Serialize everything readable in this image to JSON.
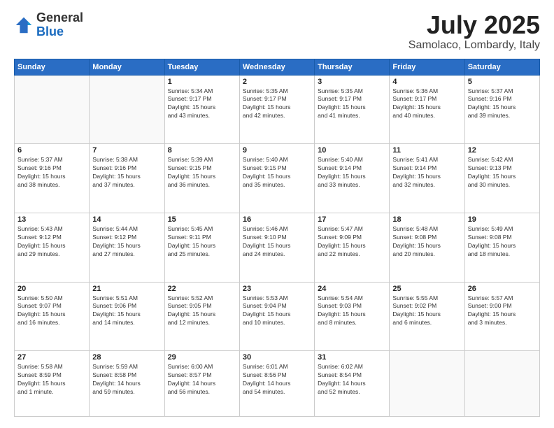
{
  "header": {
    "logo": {
      "general": "General",
      "blue": "Blue"
    },
    "title": "July 2025",
    "location": "Samolaco, Lombardy, Italy"
  },
  "calendar": {
    "days_of_week": [
      "Sunday",
      "Monday",
      "Tuesday",
      "Wednesday",
      "Thursday",
      "Friday",
      "Saturday"
    ],
    "weeks": [
      [
        {
          "day": "",
          "info": ""
        },
        {
          "day": "",
          "info": ""
        },
        {
          "day": "1",
          "info": "Sunrise: 5:34 AM\nSunset: 9:17 PM\nDaylight: 15 hours\nand 43 minutes."
        },
        {
          "day": "2",
          "info": "Sunrise: 5:35 AM\nSunset: 9:17 PM\nDaylight: 15 hours\nand 42 minutes."
        },
        {
          "day": "3",
          "info": "Sunrise: 5:35 AM\nSunset: 9:17 PM\nDaylight: 15 hours\nand 41 minutes."
        },
        {
          "day": "4",
          "info": "Sunrise: 5:36 AM\nSunset: 9:17 PM\nDaylight: 15 hours\nand 40 minutes."
        },
        {
          "day": "5",
          "info": "Sunrise: 5:37 AM\nSunset: 9:16 PM\nDaylight: 15 hours\nand 39 minutes."
        }
      ],
      [
        {
          "day": "6",
          "info": "Sunrise: 5:37 AM\nSunset: 9:16 PM\nDaylight: 15 hours\nand 38 minutes."
        },
        {
          "day": "7",
          "info": "Sunrise: 5:38 AM\nSunset: 9:16 PM\nDaylight: 15 hours\nand 37 minutes."
        },
        {
          "day": "8",
          "info": "Sunrise: 5:39 AM\nSunset: 9:15 PM\nDaylight: 15 hours\nand 36 minutes."
        },
        {
          "day": "9",
          "info": "Sunrise: 5:40 AM\nSunset: 9:15 PM\nDaylight: 15 hours\nand 35 minutes."
        },
        {
          "day": "10",
          "info": "Sunrise: 5:40 AM\nSunset: 9:14 PM\nDaylight: 15 hours\nand 33 minutes."
        },
        {
          "day": "11",
          "info": "Sunrise: 5:41 AM\nSunset: 9:14 PM\nDaylight: 15 hours\nand 32 minutes."
        },
        {
          "day": "12",
          "info": "Sunrise: 5:42 AM\nSunset: 9:13 PM\nDaylight: 15 hours\nand 30 minutes."
        }
      ],
      [
        {
          "day": "13",
          "info": "Sunrise: 5:43 AM\nSunset: 9:12 PM\nDaylight: 15 hours\nand 29 minutes."
        },
        {
          "day": "14",
          "info": "Sunrise: 5:44 AM\nSunset: 9:12 PM\nDaylight: 15 hours\nand 27 minutes."
        },
        {
          "day": "15",
          "info": "Sunrise: 5:45 AM\nSunset: 9:11 PM\nDaylight: 15 hours\nand 25 minutes."
        },
        {
          "day": "16",
          "info": "Sunrise: 5:46 AM\nSunset: 9:10 PM\nDaylight: 15 hours\nand 24 minutes."
        },
        {
          "day": "17",
          "info": "Sunrise: 5:47 AM\nSunset: 9:09 PM\nDaylight: 15 hours\nand 22 minutes."
        },
        {
          "day": "18",
          "info": "Sunrise: 5:48 AM\nSunset: 9:08 PM\nDaylight: 15 hours\nand 20 minutes."
        },
        {
          "day": "19",
          "info": "Sunrise: 5:49 AM\nSunset: 9:08 PM\nDaylight: 15 hours\nand 18 minutes."
        }
      ],
      [
        {
          "day": "20",
          "info": "Sunrise: 5:50 AM\nSunset: 9:07 PM\nDaylight: 15 hours\nand 16 minutes."
        },
        {
          "day": "21",
          "info": "Sunrise: 5:51 AM\nSunset: 9:06 PM\nDaylight: 15 hours\nand 14 minutes."
        },
        {
          "day": "22",
          "info": "Sunrise: 5:52 AM\nSunset: 9:05 PM\nDaylight: 15 hours\nand 12 minutes."
        },
        {
          "day": "23",
          "info": "Sunrise: 5:53 AM\nSunset: 9:04 PM\nDaylight: 15 hours\nand 10 minutes."
        },
        {
          "day": "24",
          "info": "Sunrise: 5:54 AM\nSunset: 9:03 PM\nDaylight: 15 hours\nand 8 minutes."
        },
        {
          "day": "25",
          "info": "Sunrise: 5:55 AM\nSunset: 9:02 PM\nDaylight: 15 hours\nand 6 minutes."
        },
        {
          "day": "26",
          "info": "Sunrise: 5:57 AM\nSunset: 9:00 PM\nDaylight: 15 hours\nand 3 minutes."
        }
      ],
      [
        {
          "day": "27",
          "info": "Sunrise: 5:58 AM\nSunset: 8:59 PM\nDaylight: 15 hours\nand 1 minute."
        },
        {
          "day": "28",
          "info": "Sunrise: 5:59 AM\nSunset: 8:58 PM\nDaylight: 14 hours\nand 59 minutes."
        },
        {
          "day": "29",
          "info": "Sunrise: 6:00 AM\nSunset: 8:57 PM\nDaylight: 14 hours\nand 56 minutes."
        },
        {
          "day": "30",
          "info": "Sunrise: 6:01 AM\nSunset: 8:56 PM\nDaylight: 14 hours\nand 54 minutes."
        },
        {
          "day": "31",
          "info": "Sunrise: 6:02 AM\nSunset: 8:54 PM\nDaylight: 14 hours\nand 52 minutes."
        },
        {
          "day": "",
          "info": ""
        },
        {
          "day": "",
          "info": ""
        }
      ]
    ]
  }
}
